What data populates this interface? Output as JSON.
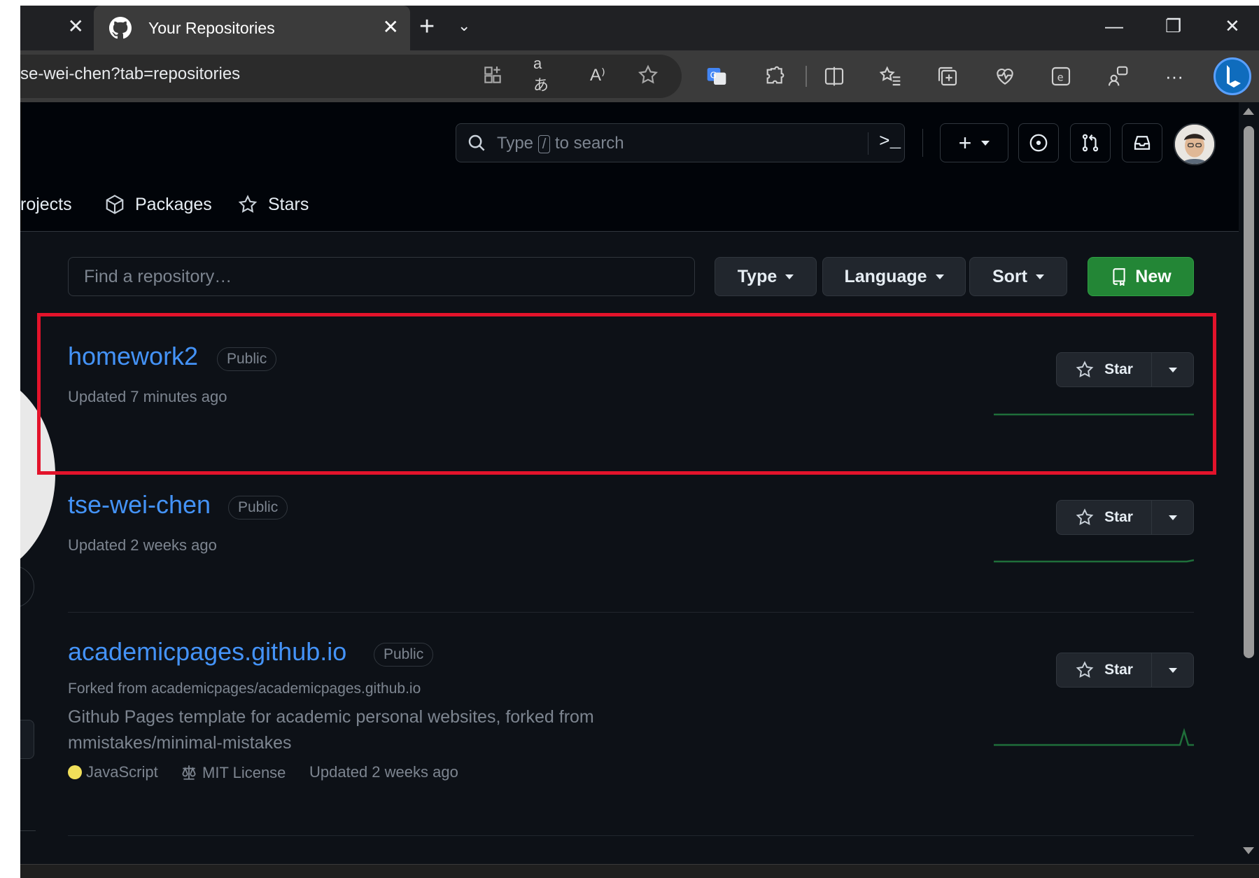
{
  "browser": {
    "prev_tab_close": "✕",
    "active_tab_title": "Your Repositories",
    "active_tab_close": "✕",
    "new_tab": "+",
    "address_url": "se-wei-chen?tab=repositories",
    "more_label": "···"
  },
  "header": {
    "search_prefix": "Type",
    "search_key": "/",
    "search_suffix": "to search",
    "command_palette": ">_",
    "create_plus": "+"
  },
  "nav": {
    "projects_label": "rojects",
    "packages_label": "Packages",
    "stars_label": "Stars"
  },
  "filters": {
    "search_placeholder": "Find a repository…",
    "type_label": "Type",
    "language_label": "Language",
    "sort_label": "Sort",
    "new_label": "New"
  },
  "repos": [
    {
      "name": "homework2",
      "visibility": "Public",
      "updated": "Updated 7 minutes ago",
      "star_label": "Star"
    },
    {
      "name": "tse-wei-chen",
      "visibility": "Public",
      "updated": "Updated 2 weeks ago",
      "star_label": "Star"
    },
    {
      "name": "academicpages.github.io",
      "visibility": "Public",
      "forked_from": "Forked from academicpages/academicpages.github.io",
      "description": "Github Pages template for academic personal websites, forked from mmistakes/minimal-mistakes",
      "language": "JavaScript",
      "language_color": "#f1e05a",
      "license": "MIT License",
      "updated": "Updated 2 weeks ago",
      "star_label": "Star"
    }
  ],
  "colors": {
    "accent_link": "#4493f8",
    "new_button": "#238636",
    "highlight_box": "#e3132b",
    "sparkline": "#1f6f3a"
  }
}
